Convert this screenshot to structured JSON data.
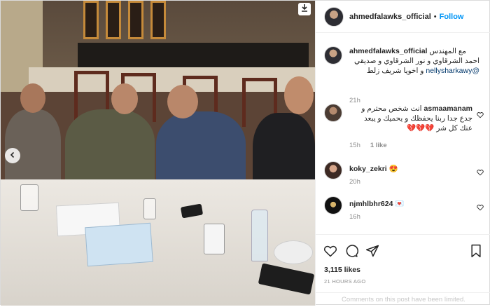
{
  "post": {
    "username": "ahmedfalawks_official",
    "follow_label": "Follow",
    "separator": "•"
  },
  "caption": {
    "username": "ahmedfalawks_official",
    "line1": "مع المهندس",
    "line2": "احمد الشرقاوي و نور الشرقاوي و صديقي",
    "mention": "@nellysharkawy",
    "line3_tail": " و اخويا شريف زلط",
    "time": "21h"
  },
  "comments": [
    {
      "username": "asmaamanam",
      "text": "انت شخص محترم و جدع جدا ربنا يحفظك و يحميك و يبعد عنك كل شر",
      "emoji": "💔💔💔",
      "time": "15h",
      "likes": "1 like"
    },
    {
      "username": "koky_zekri",
      "text": "😍",
      "time": "20h"
    },
    {
      "username": "njmhlbhr624",
      "text": "💌",
      "time": "16h"
    }
  ],
  "actions": {
    "likes": "3,115 likes",
    "timestamp": "21 HOURS AGO",
    "limited_notice": "Comments on this post have been limited."
  },
  "colors": {
    "accent": "#0095f6",
    "text": "#262626",
    "muted": "#8e8e8e",
    "border": "#dbdbdb"
  },
  "icons": [
    "download-icon",
    "chevron-left-icon",
    "heart-icon",
    "comment-icon",
    "share-icon",
    "bookmark-icon"
  ]
}
